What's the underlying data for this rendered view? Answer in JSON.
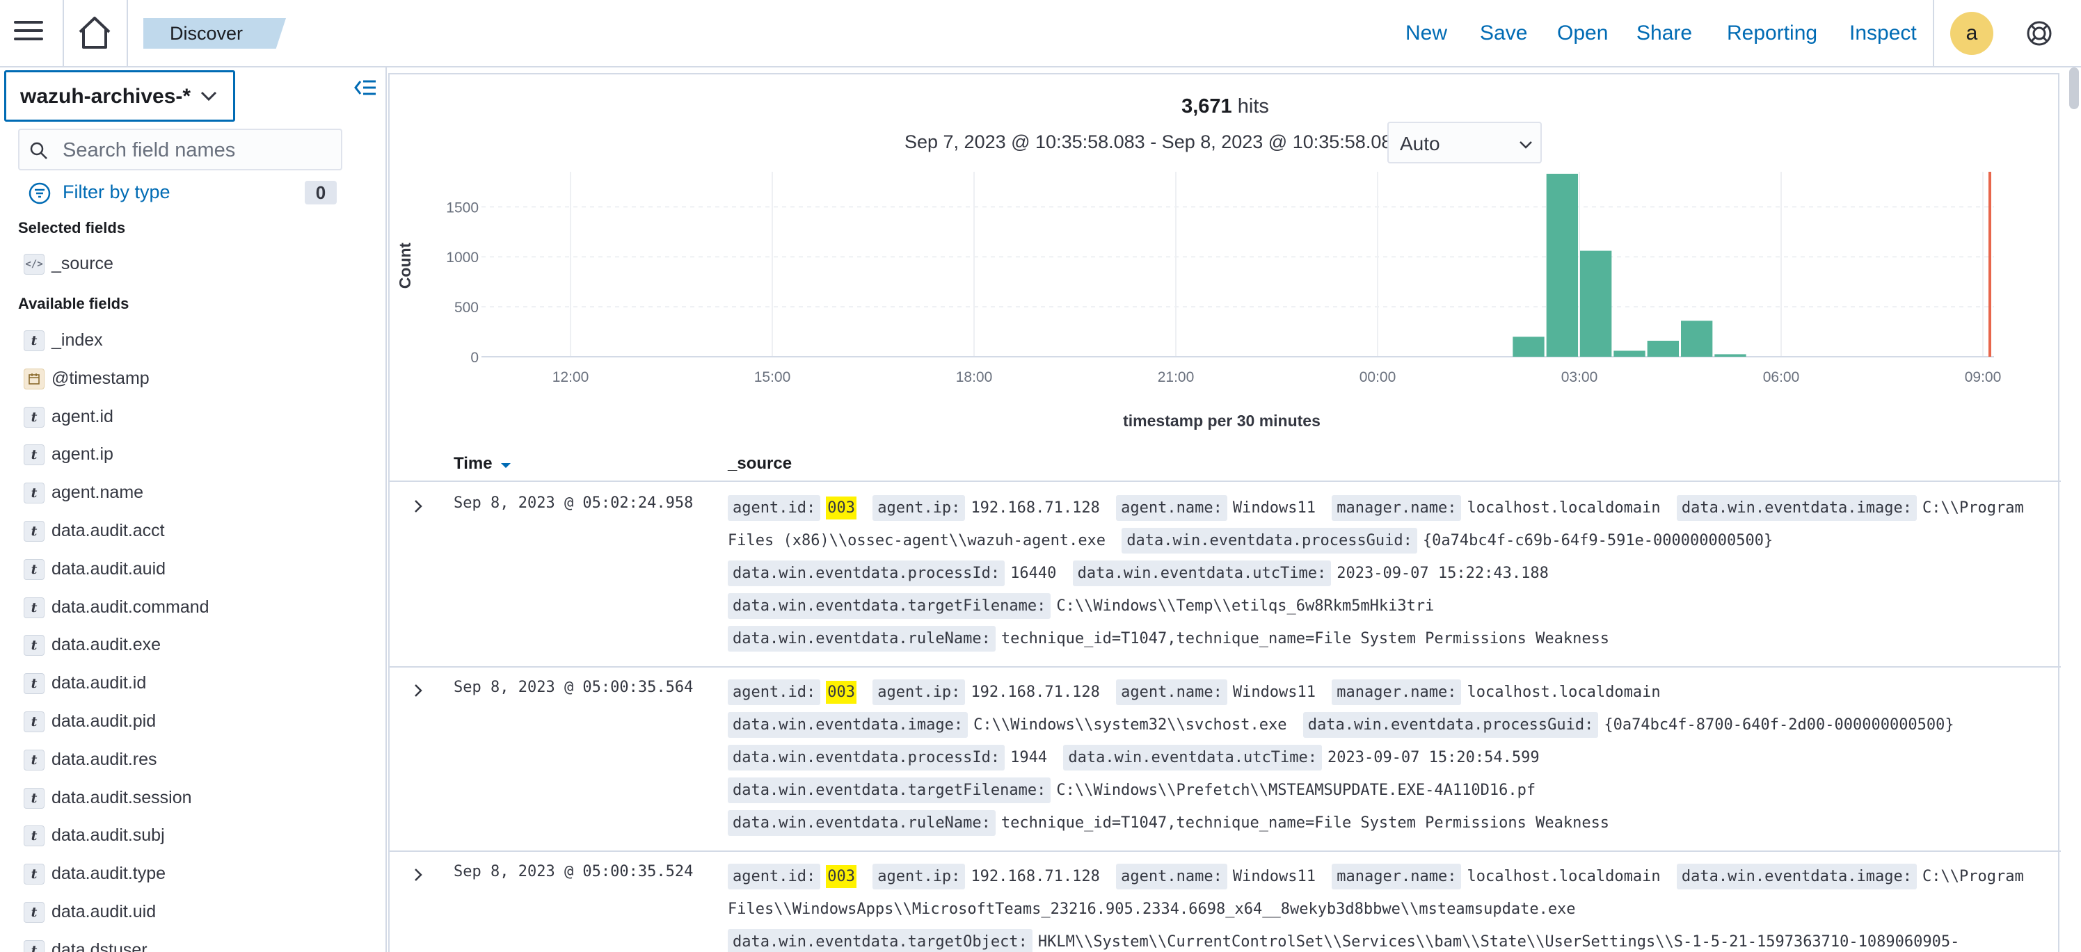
{
  "header": {
    "breadcrumb": "Discover",
    "links": [
      "New",
      "Save",
      "Open",
      "Share",
      "Reporting",
      "Inspect"
    ],
    "avatar_initial": "a"
  },
  "sidebar": {
    "index_pattern": "wazuh-archives-*",
    "search_placeholder": "Search field names",
    "filter_label": "Filter by type",
    "filter_count": "0",
    "selected_title": "Selected fields",
    "selected_fields": [
      {
        "name": "_source",
        "type": "source"
      }
    ],
    "available_title": "Available fields",
    "available_fields": [
      {
        "name": "_index",
        "type": "t"
      },
      {
        "name": "@timestamp",
        "type": "date"
      },
      {
        "name": "agent.id",
        "type": "t"
      },
      {
        "name": "agent.ip",
        "type": "t"
      },
      {
        "name": "agent.name",
        "type": "t"
      },
      {
        "name": "data.audit.acct",
        "type": "t"
      },
      {
        "name": "data.audit.auid",
        "type": "t"
      },
      {
        "name": "data.audit.command",
        "type": "t"
      },
      {
        "name": "data.audit.exe",
        "type": "t"
      },
      {
        "name": "data.audit.id",
        "type": "t"
      },
      {
        "name": "data.audit.pid",
        "type": "t"
      },
      {
        "name": "data.audit.res",
        "type": "t"
      },
      {
        "name": "data.audit.session",
        "type": "t"
      },
      {
        "name": "data.audit.subj",
        "type": "t"
      },
      {
        "name": "data.audit.type",
        "type": "t"
      },
      {
        "name": "data.audit.uid",
        "type": "t"
      },
      {
        "name": "data.dstuser",
        "type": "t"
      }
    ]
  },
  "main": {
    "hits_count": "3,671",
    "hits_label": "hits",
    "time_range": "Sep 7, 2023 @ 10:35:58.083 - Sep 8, 2023 @ 10:35:58.083",
    "interval": "Auto",
    "table": {
      "col_time": "Time",
      "col_source": "_source",
      "rows": [
        {
          "time": "Sep 8, 2023 @ 05:02:24.958",
          "fields": [
            {
              "k": "agent.id:",
              "v": "003",
              "hl": true
            },
            {
              "k": "agent.ip:",
              "v": "192.168.71.128"
            },
            {
              "k": "agent.name:",
              "v": "Windows11"
            },
            {
              "k": "manager.name:",
              "v": "localhost.localdomain"
            },
            {
              "k": "data.win.eventdata.image:",
              "v": "C:\\\\Program Files (x86)\\\\ossec-agent\\\\wazuh-agent.exe"
            },
            {
              "k": "data.win.eventdata.processGuid:",
              "v": "{0a74bc4f-c69b-64f9-591e-000000000500}"
            },
            {
              "k": "data.win.eventdata.processId:",
              "v": "16440"
            },
            {
              "k": "data.win.eventdata.utcTime:",
              "v": "2023-09-07 15:22:43.188"
            },
            {
              "k": "data.win.eventdata.targetFilename:",
              "v": "C:\\\\Windows\\\\Temp\\\\etilqs_6w8Rkm5mHki3tri"
            },
            {
              "k": "data.win.eventdata.ruleName:",
              "v": "technique_id=T1047,technique_name=File System Permissions Weakness"
            }
          ]
        },
        {
          "time": "Sep 8, 2023 @ 05:00:35.564",
          "fields": [
            {
              "k": "agent.id:",
              "v": "003",
              "hl": true
            },
            {
              "k": "agent.ip:",
              "v": "192.168.71.128"
            },
            {
              "k": "agent.name:",
              "v": "Windows11"
            },
            {
              "k": "manager.name:",
              "v": "localhost.localdomain"
            },
            {
              "k": "data.win.eventdata.image:",
              "v": "C:\\\\Windows\\\\system32\\\\svchost.exe"
            },
            {
              "k": "data.win.eventdata.processGuid:",
              "v": "{0a74bc4f-8700-640f-2d00-000000000500}"
            },
            {
              "k": "data.win.eventdata.processId:",
              "v": "1944"
            },
            {
              "k": "data.win.eventdata.utcTime:",
              "v": "2023-09-07 15:20:54.599"
            },
            {
              "k": "data.win.eventdata.targetFilename:",
              "v": "C:\\\\Windows\\\\Prefetch\\\\MSTEAMSUPDATE.EXE-4A110D16.pf"
            },
            {
              "k": "data.win.eventdata.ruleName:",
              "v": "technique_id=T1047,technique_name=File System Permissions Weakness"
            }
          ]
        },
        {
          "time": "Sep 8, 2023 @ 05:00:35.524",
          "fields": [
            {
              "k": "agent.id:",
              "v": "003",
              "hl": true
            },
            {
              "k": "agent.ip:",
              "v": "192.168.71.128"
            },
            {
              "k": "agent.name:",
              "v": "Windows11"
            },
            {
              "k": "manager.name:",
              "v": "localhost.localdomain"
            },
            {
              "k": "data.win.eventdata.image:",
              "v": "C:\\\\Program Files\\\\WindowsApps\\\\MicrosoftTeams_23216.905.2334.6698_x64__8wekyb3d8bbwe\\\\msteamsupdate.exe"
            },
            {
              "k": "data.win.eventdata.targetObject:",
              "v": "HKLM\\\\System\\\\CurrentControlSet\\\\Services\\\\bam\\\\State\\\\UserSettings\\\\S-1-5-21-1597363710-1089060905-"
            }
          ]
        }
      ]
    }
  },
  "colors": {
    "accent": "#006bb4",
    "bar": "#54b399",
    "now_marker": "#e7664c",
    "highlight": "#fff200"
  },
  "chart_data": {
    "type": "bar",
    "title": "",
    "xlabel": "timestamp per 30 minutes",
    "ylabel": "Count",
    "x_ticks": [
      "12:00",
      "15:00",
      "18:00",
      "21:00",
      "00:00",
      "03:00",
      "06:00",
      "09:00"
    ],
    "y_ticks": [
      0,
      500,
      1000,
      1500
    ],
    "ylim": [
      0,
      1850
    ],
    "bin_minutes": 30,
    "categories": [
      "02:00",
      "02:30",
      "03:00",
      "03:30",
      "04:00",
      "04:30",
      "05:00"
    ],
    "values": [
      200,
      1830,
      1060,
      60,
      160,
      360,
      25
    ],
    "grid": true,
    "legend": "none"
  }
}
